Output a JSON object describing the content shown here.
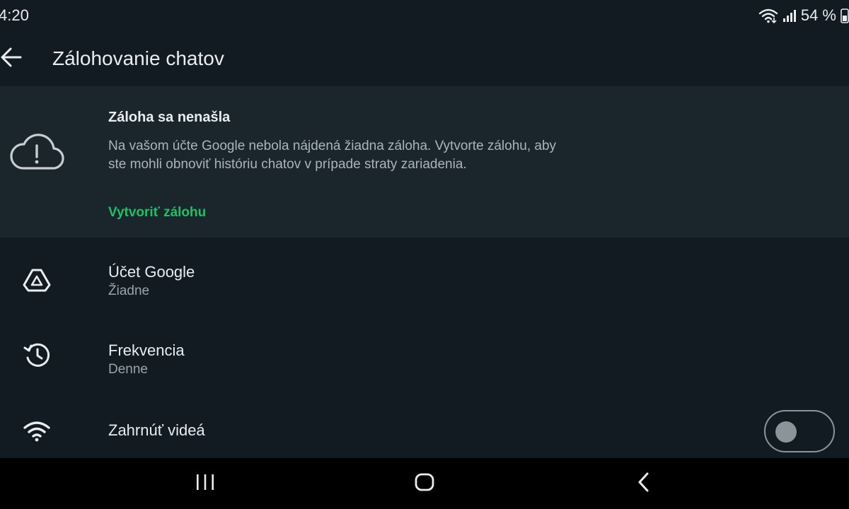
{
  "status_bar": {
    "time": "4:20",
    "battery": "54 %",
    "icons": [
      "wifi-icon",
      "signal-icon",
      "battery-icon"
    ]
  },
  "app_bar": {
    "title": "Zálohovanie chatov",
    "back_icon": "arrow-left-icon"
  },
  "backup_card": {
    "icon": "cloud-alert-icon",
    "title": "Záloha sa nenašla",
    "description": "Na vašom účte Google nebola nájdená žiadna záloha. Vytvorte zálohu, aby ste mohli obnoviť históriu chatov v prípade straty zariadenia.",
    "action": "Vytvoriť zálohu"
  },
  "settings": [
    {
      "icon": "google-drive-icon",
      "title": "Účet Google",
      "subtitle": "Žiadne"
    },
    {
      "icon": "history-icon",
      "title": "Frekvencia",
      "subtitle": "Denne"
    },
    {
      "icon": "wifi-icon",
      "title": "Zahrnúť videá",
      "toggle_on": false
    }
  ],
  "nav_bar": {
    "icons": [
      "recent-apps-icon",
      "home-icon",
      "back-icon"
    ]
  },
  "colors": {
    "background": "#111b21",
    "card": "#1b252c",
    "accent": "#21c063",
    "text_primary": "#e9edef",
    "text_secondary": "#aab4b9"
  }
}
